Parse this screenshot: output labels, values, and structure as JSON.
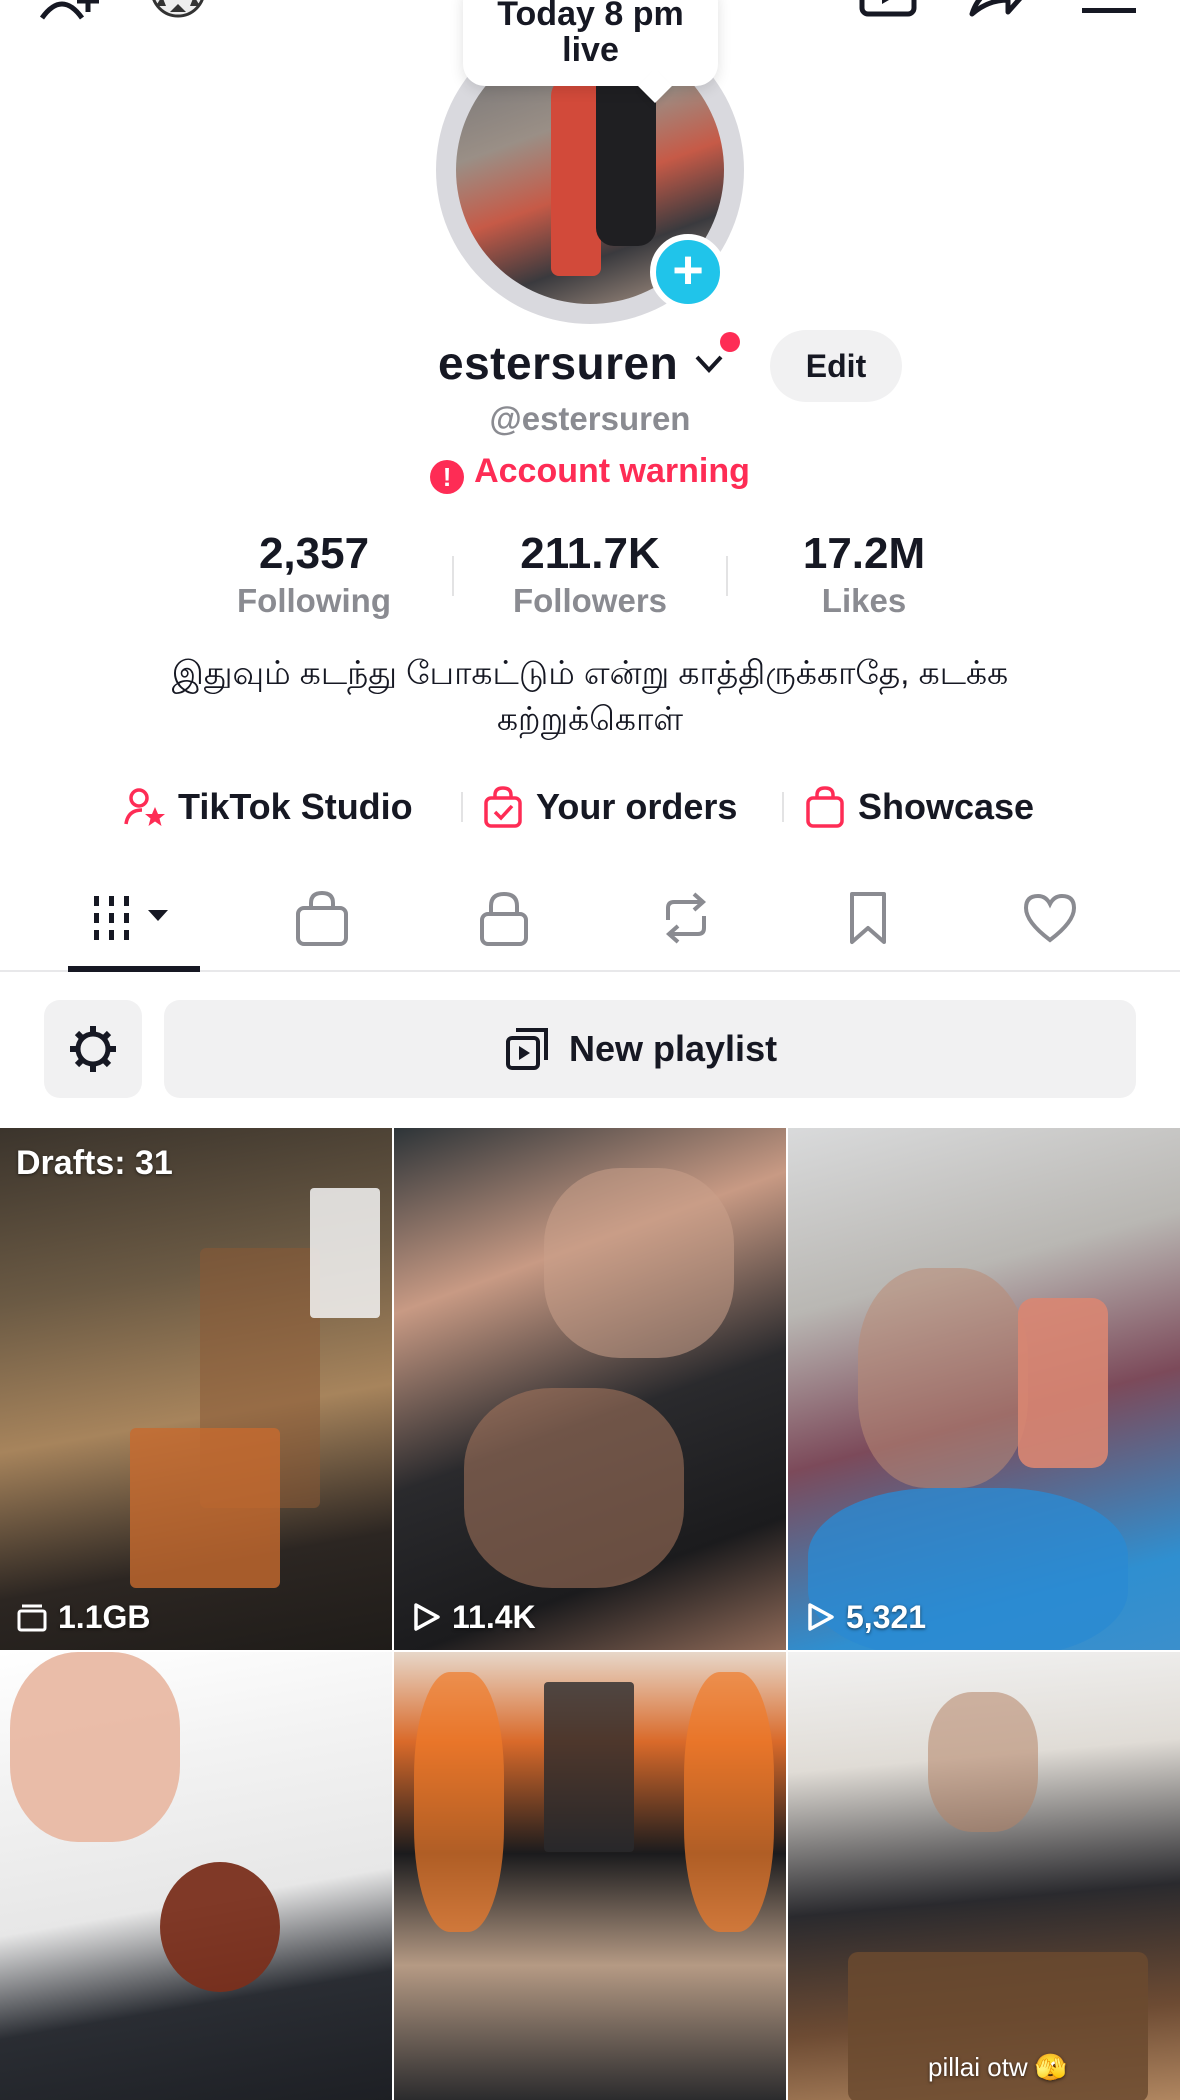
{
  "live_bubble": {
    "line1": "Today 8 pm",
    "line2": "live"
  },
  "profile": {
    "display_name": "estersuren",
    "handle": "@estersuren",
    "edit_label": "Edit",
    "warning_text": "Account warning",
    "bio": "இதுவும் கடந்து போகட்டும் என்று காத்திருக்காதே, கடக்க கற்றுக்கொள்"
  },
  "stats": [
    {
      "value": "2,357",
      "label": "Following"
    },
    {
      "value": "211.7K",
      "label": "Followers"
    },
    {
      "value": "17.2M",
      "label": "Likes"
    }
  ],
  "links": [
    {
      "label": "TikTok Studio",
      "icon": "user-star-icon"
    },
    {
      "label": "Your orders",
      "icon": "shopping-bag-check-icon"
    },
    {
      "label": "Showcase",
      "icon": "shopping-bag-icon"
    }
  ],
  "tabs": [
    {
      "name": "videos",
      "icon": "grid-icon",
      "active": true
    },
    {
      "name": "shop",
      "icon": "bag-icon"
    },
    {
      "name": "private",
      "icon": "lock-icon"
    },
    {
      "name": "reposts",
      "icon": "repost-icon"
    },
    {
      "name": "saved",
      "icon": "bookmark-icon"
    },
    {
      "name": "liked",
      "icon": "heart-icon"
    }
  ],
  "playlist": {
    "label": "New playlist"
  },
  "grid": [
    {
      "top_label": "Drafts: 31",
      "bottom_label": "1.1GB",
      "bottom_icon": "drafts-icon"
    },
    {
      "bottom_label": "11.4K",
      "bottom_icon": "play-icon"
    },
    {
      "bottom_label": "5,321",
      "bottom_icon": "play-icon"
    },
    {
      "overlay": ""
    },
    {
      "overlay": ""
    },
    {
      "overlay": "pillai otw 🫣"
    }
  ],
  "colors": {
    "accent": "#fe2c55",
    "plus_button": "#20c4ea",
    "muted_text": "#8a8b91",
    "chip_bg": "#f1f1f2"
  }
}
